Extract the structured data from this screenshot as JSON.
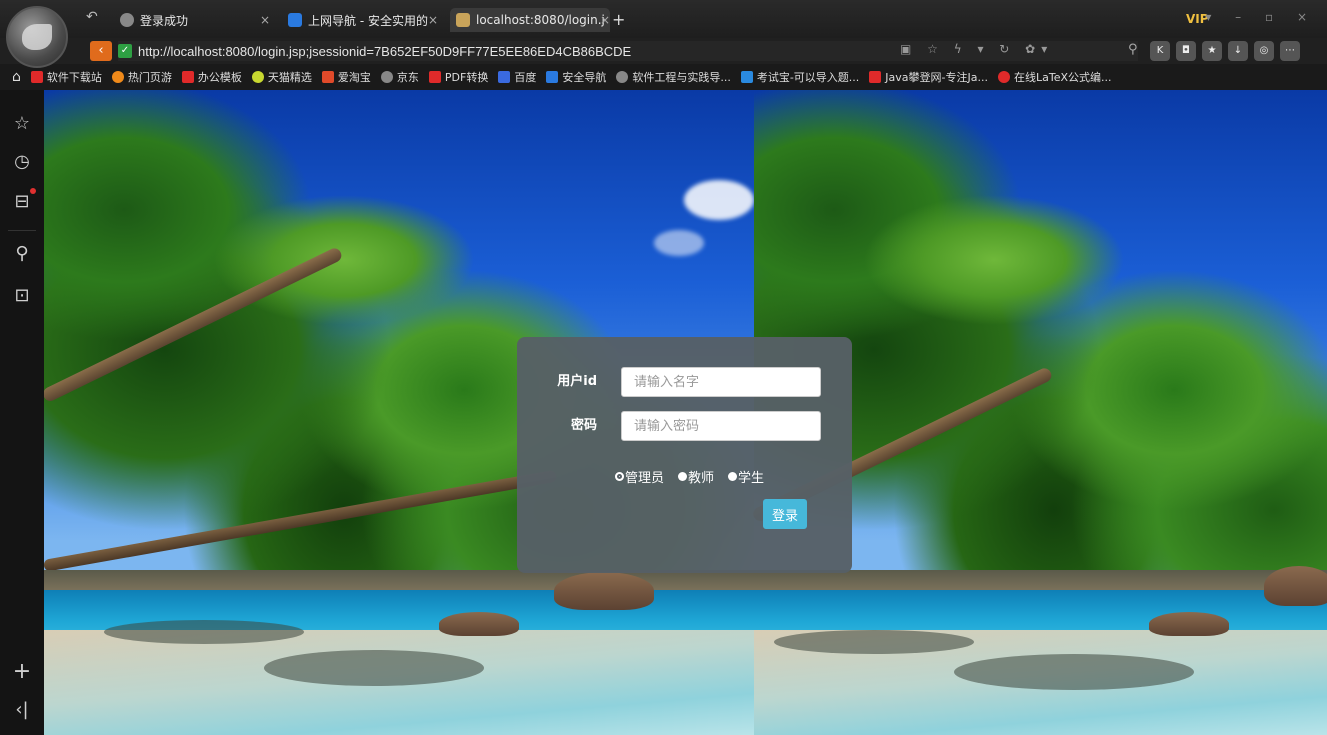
{
  "browser": {
    "tabs": [
      {
        "label": "登录成功",
        "icon": "globe-icon"
      },
      {
        "label": "上网导航 - 安全实用的",
        "icon": "shield-nav-icon"
      },
      {
        "label": "localhost:8080/login.j",
        "icon": "page-icon",
        "active": true
      }
    ],
    "new_tab": "+",
    "vip_label": "VIP",
    "url": "http://localhost:8080/login.jsp;jsessionid=7B652EF50D9FF77E5EE86ED4CB86BCDE",
    "bookmarks": [
      {
        "label": "软件下载站",
        "color": "#e02a2a"
      },
      {
        "label": "热门页游",
        "color": "#f08a1a"
      },
      {
        "label": "办公模板",
        "color": "#e02a2a"
      },
      {
        "label": "天猫精选",
        "color": "#c8d830"
      },
      {
        "label": "爱淘宝",
        "color": "#e04a2a"
      },
      {
        "label": "京东",
        "color": "#888888"
      },
      {
        "label": "PDF转换",
        "color": "#e02a2a"
      },
      {
        "label": "百度",
        "color": "#3a6ae0"
      },
      {
        "label": "安全导航",
        "color": "#2a7ae0"
      },
      {
        "label": "软件工程与实践导...",
        "color": "#888888"
      },
      {
        "label": "考试宝-可以导入题...",
        "color": "#2a8ae0"
      },
      {
        "label": "Java攀登网-专注Ja...",
        "color": "#e02a2a"
      },
      {
        "label": "在线LaTeX公式编...",
        "color": "#e02a2a"
      }
    ]
  },
  "sidebar": {
    "icons": [
      "star-icon",
      "history-icon",
      "toolbox-icon",
      "search-icon",
      "game-icon",
      "add-icon",
      "collapse-icon"
    ]
  },
  "login": {
    "userid_label": "用户id",
    "userid_placeholder": "请输入名字",
    "password_label": "密码",
    "password_placeholder": "请输入密码",
    "roles": [
      {
        "label": "管理员",
        "checked": true
      },
      {
        "label": "教师",
        "checked": false
      },
      {
        "label": "学生",
        "checked": false
      }
    ],
    "submit_label": "登录"
  }
}
